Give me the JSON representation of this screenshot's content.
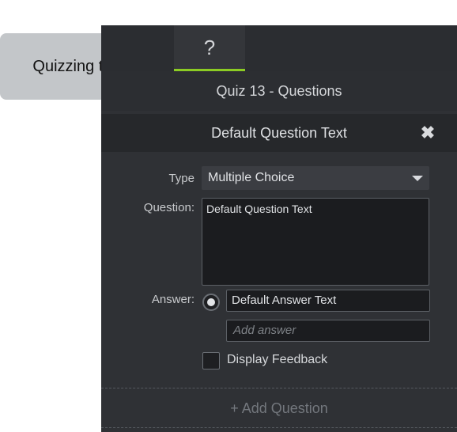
{
  "callout": {
    "text": "Quizzing tab"
  },
  "tabs": {
    "quiz_icon": "?",
    "quiz_icon_name": "question-mark-icon",
    "accent": "#8ccc24"
  },
  "quiz": {
    "title": "Quiz 13 - Questions"
  },
  "question_panel": {
    "header": "Default Question Text",
    "close_icon": "✖",
    "type_label": "Type",
    "type_value": "Multiple Choice",
    "question_label": "Question:",
    "question_value": "Default Question Text",
    "answer_label": "Answer:",
    "answer_value": "Default Answer Text",
    "add_answer_placeholder": "Add answer",
    "feedback_label": "Display Feedback"
  },
  "footer": {
    "add_question": "+ Add Question"
  }
}
